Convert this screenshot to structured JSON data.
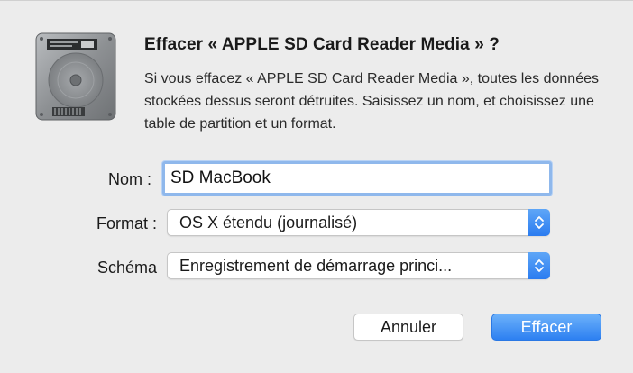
{
  "dialog": {
    "title": "Effacer « APPLE SD Card Reader Media » ?",
    "message": "Si vous effacez « APPLE SD Card Reader Media », toutes les données stockées dessus seront détruites. Saisissez un nom, et choisissez une table de partition et un format.",
    "icon": "hard-drive-icon"
  },
  "form": {
    "name_label": "Nom :",
    "name_value": "SD MacBook",
    "format_label": "Format :",
    "format_value": "OS X étendu (journalisé)",
    "scheme_label": "Schéma",
    "scheme_value": "Enregistrement de démarrage princi..."
  },
  "buttons": {
    "cancel_label": "Annuler",
    "erase_label": "Effacer"
  },
  "colors": {
    "accent": "#2d80f1",
    "background": "#ececec",
    "focus_ring": "#8fb8ec"
  }
}
